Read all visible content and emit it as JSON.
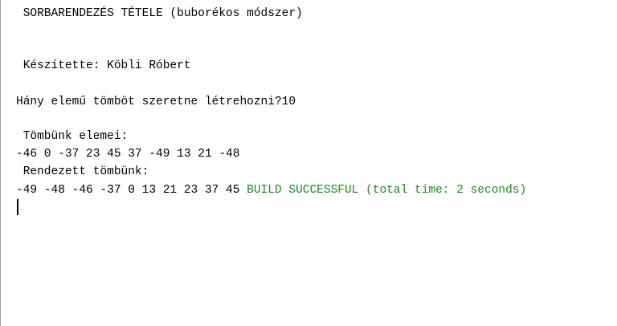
{
  "console": {
    "lines": [
      " SORBARENDEZÉS TÉTELE (buborékos módszer)",
      " Készítette: Köbli Róbert",
      "Hány elemű tömböt szeretne létrehozni?10",
      " Tömbünk elemei:",
      "-46 0 -37 23 45 37 -49 13 21 -48",
      " Rendezett tömbünk:",
      "-49 -48 -46 -37 0 13 21 23 37 45 "
    ],
    "build_status": "BUILD SUCCESSFUL (total time: 2 seconds)",
    "colors": {
      "text": "#000000",
      "success": "#1f8a1f",
      "background": "#ffffff"
    }
  }
}
